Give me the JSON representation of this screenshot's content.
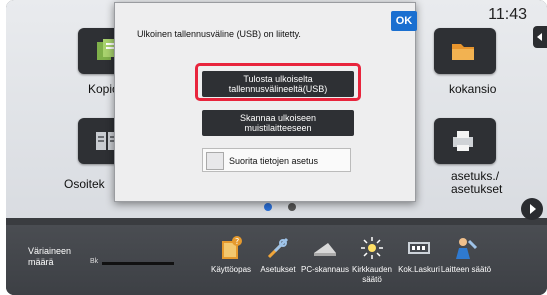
{
  "clock": "11:43",
  "tiles": {
    "copy": "Kopioi",
    "folder": "kokansio",
    "address": "Osoitek",
    "settings": "asetuks./\nasetukset"
  },
  "dialog": {
    "message": "Ulkoinen tallennusväline (USB) on liitetty.",
    "ok": "OK",
    "print_usb": "Tulosta ulkoiselta\ntallennusvälineeltä(USB)",
    "scan_usb": "Skannaa ulkoiseen\nmuistilaitteeseen",
    "data_settings": "Suorita tietojen asetus"
  },
  "toner": {
    "label": "Väriaineen\nmäärä",
    "bk": "Bk",
    "level": 1.0
  },
  "dock": [
    {
      "label": "Käyttöopas",
      "icon": "manual-icon"
    },
    {
      "label": "Asetukset",
      "icon": "tools-icon"
    },
    {
      "label": "PC-skannaus",
      "icon": "pc-scan-icon"
    },
    {
      "label": "Kirkkauden\nsäätö",
      "icon": "brightness-icon"
    },
    {
      "label": "Kok.Laskuri",
      "icon": "counter-icon"
    },
    {
      "label": "Laitteen säätö",
      "icon": "device-adjust-icon"
    }
  ],
  "colors": {
    "accent": "#1a6fd0",
    "highlight": "#e8243c",
    "dark_button": "#2e3034"
  }
}
